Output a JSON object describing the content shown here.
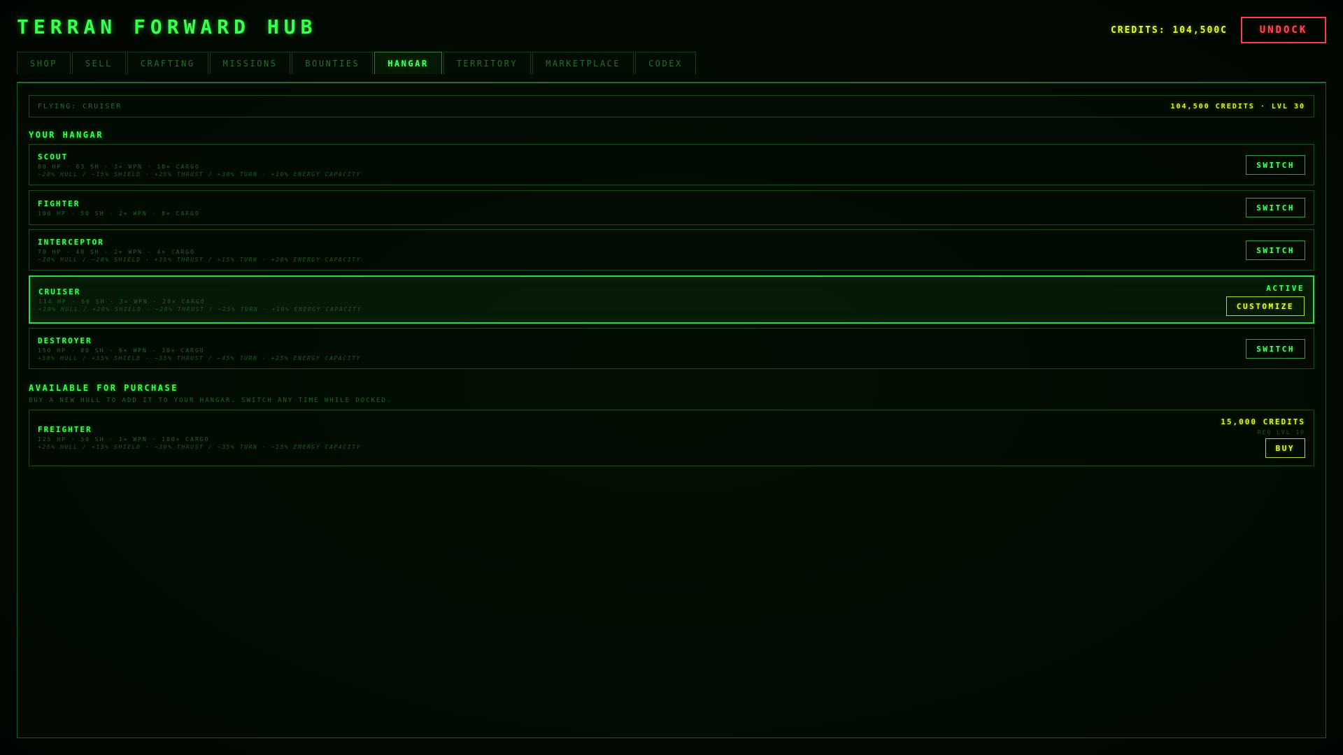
{
  "header": {
    "title": "TERRAN FORWARD HUB",
    "credits": "CREDITS: 104,500C",
    "undock_label": "UNDOCK"
  },
  "tabs": [
    {
      "label": "SHOP"
    },
    {
      "label": "SELL"
    },
    {
      "label": "CRAFTING"
    },
    {
      "label": "MISSIONS"
    },
    {
      "label": "BOUNTIES"
    },
    {
      "label": "HANGAR",
      "active": true
    },
    {
      "label": "TERRITORY"
    },
    {
      "label": "MARKETPLACE"
    },
    {
      "label": "CODEX"
    }
  ],
  "status": {
    "flying": "FLYING: CRUISER",
    "summary": "104,500 CREDITS · LVL 30"
  },
  "hangar": {
    "title": "YOUR HANGAR",
    "ships": [
      {
        "name": "SCOUT",
        "stats": "80 HP · 63 SH · 3× WPN · 18× CARGO",
        "mods": "−20% HULL / −15% SHIELD · +25% THRUST / +30% TURN · +10% ENERGY CAPACITY",
        "button": "SWITCH"
      },
      {
        "name": "FIGHTER",
        "stats": "100 HP · 50 SH · 2× WPN · 8× CARGO",
        "mods": "",
        "button": "SWITCH"
      },
      {
        "name": "INTERCEPTOR",
        "stats": "70 HP · 40 SH · 2× WPN · 4× CARGO",
        "mods": "−30% HULL / −20% SHIELD · +35% THRUST / +15% TURN · +20% ENERGY CAPACITY",
        "button": "SWITCH"
      },
      {
        "name": "CRUISER",
        "stats": "114 HP · 60 SH · 3× WPN · 20× CARGO",
        "mods": "+10% HULL / +20% SHIELD · −20% THRUST / −25% TURN · +10% ENERGY CAPACITY",
        "status": "ACTIVE",
        "button": "CUSTOMIZE"
      },
      {
        "name": "DESTROYER",
        "stats": "150 HP · 80 SH · 6× WPN · 30× CARGO",
        "mods": "+50% HULL / +35% SHIELD · −35% THRUST / −45% TURN · +25% ENERGY CAPACITY",
        "button": "SWITCH"
      }
    ]
  },
  "purchase": {
    "title": "AVAILABLE FOR PURCHASE",
    "subtitle": "BUY A NEW HULL TO ADD IT TO YOUR HANGAR. SWITCH ANY TIME WHILE DOCKED.",
    "ships": [
      {
        "name": "FREIGHTER",
        "stats": "125 HP · 50 SH · 1× WPN · 100× CARGO",
        "mods": "+25% HULL / +15% SHIELD · −30% THRUST / −35% TURN · −15% ENERGY CAPACITY",
        "price": "15,000 CREDITS",
        "requirement": "REQ LVL 10",
        "button": "BUY"
      }
    ]
  },
  "colors": {
    "accent": "#39ff4f",
    "credits": "#d9f52b",
    "danger": "#ff3b50",
    "background": "#020b02"
  }
}
